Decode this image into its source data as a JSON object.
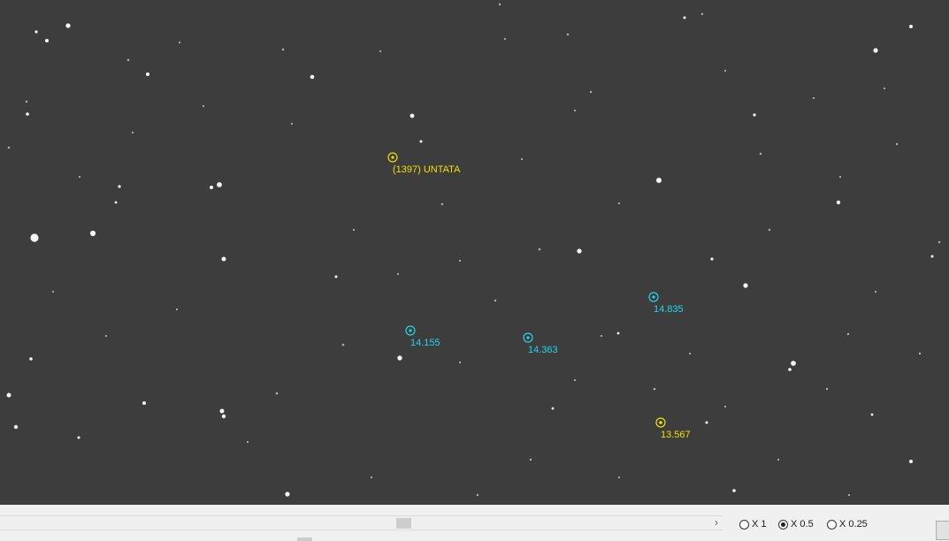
{
  "markers": [
    {
      "label": "(1397) UNTATA",
      "color": "#f0e000"
    },
    {
      "label": "14.155",
      "color": "#20d8e8"
    },
    {
      "label": "14.363",
      "color": "#20d8e8"
    },
    {
      "label": "14.835",
      "color": "#20d8e8"
    },
    {
      "label": "13.567",
      "color": "#f0e000"
    }
  ],
  "zoom_options": [
    {
      "label": "X 1",
      "selected": false
    },
    {
      "label": "X 0.5",
      "selected": true
    },
    {
      "label": "X 0.25",
      "selected": false
    }
  ],
  "scroll_arrow": "›",
  "colors": {
    "sky": "#3d3d3d",
    "star": "#ffffff",
    "yellow": "#f0e000",
    "cyan": "#20d8e8"
  }
}
